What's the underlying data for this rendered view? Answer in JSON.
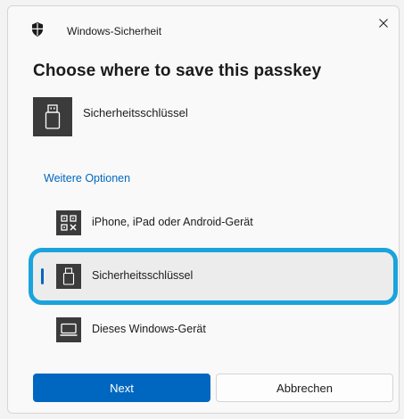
{
  "window": {
    "title": "Windows-Sicherheit"
  },
  "heading": "Choose where to save this passkey",
  "selected": {
    "label": "Sicherheitsschlüssel",
    "icon": "usb-key-icon"
  },
  "more_options": "Weitere Optionen",
  "options": [
    {
      "label": "iPhone, iPad oder Android-Gerät",
      "icon": "qr-code-icon"
    },
    {
      "label": "Sicherheitsschlüssel",
      "icon": "usb-key-icon",
      "selected": true
    },
    {
      "label": "Dieses Windows-Gerät",
      "icon": "laptop-icon"
    }
  ],
  "buttons": {
    "next": "Next",
    "cancel": "Abbrechen"
  },
  "colors": {
    "accent": "#0067c0",
    "highlight": "#1aa3dc",
    "tile": "#3b3b3b"
  }
}
